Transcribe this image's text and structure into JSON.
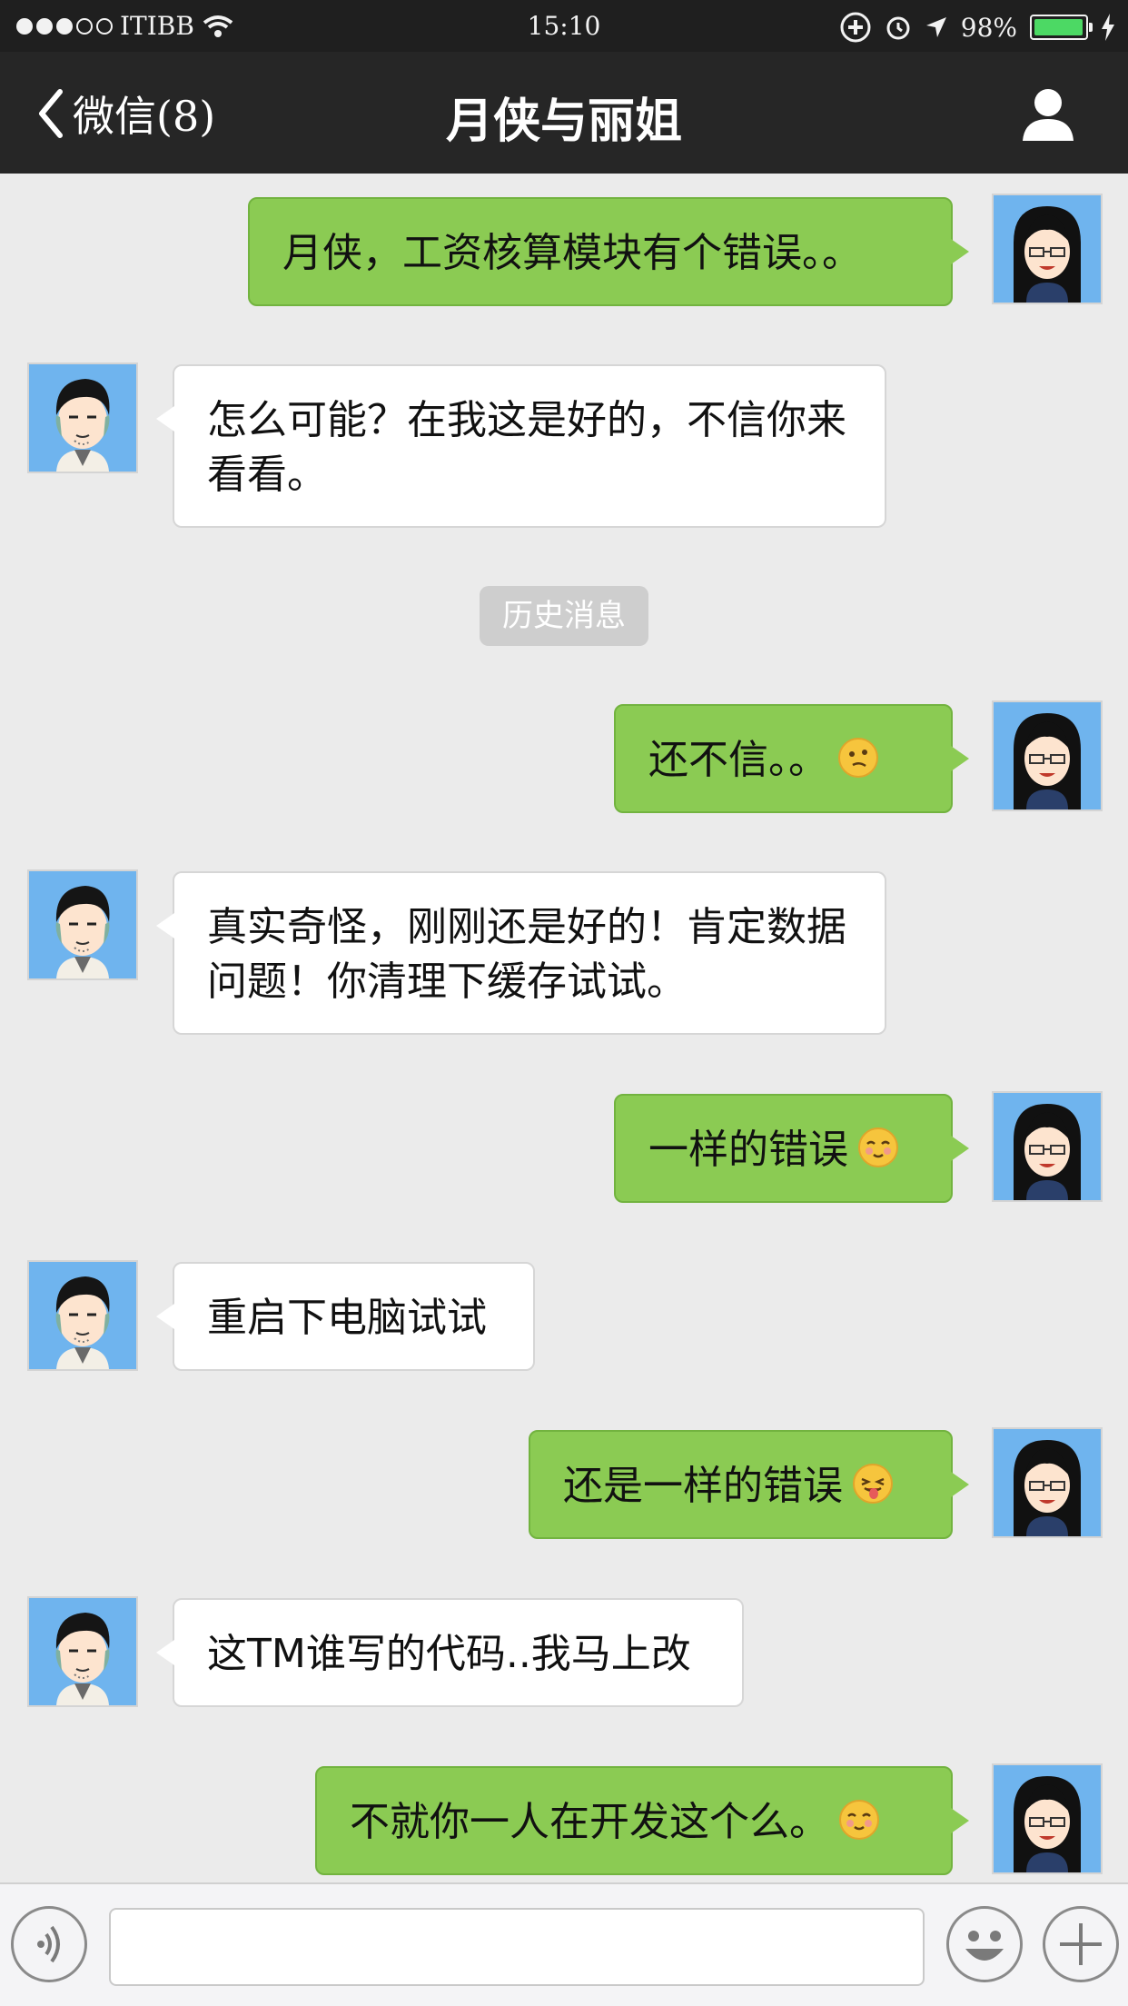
{
  "status_bar": {
    "carrier": "ITIBB",
    "time": "15:10",
    "battery": "98%",
    "battery_level": 0.98
  },
  "nav": {
    "back_label": "微信(8)",
    "title": "月侠与丽姐"
  },
  "history_label": "历史消息",
  "messages": [
    {
      "side": "sent",
      "text": "月侠，工资核算模块有个错误。。",
      "emoji": ""
    },
    {
      "side": "recv",
      "text": "怎么可能？在我这是好的，不信你来看看。",
      "emoji": ""
    },
    {
      "side": "sent",
      "text": "还不信。。",
      "emoji": "thinking-face"
    },
    {
      "side": "recv",
      "text": "真实奇怪，刚刚还是好的！肯定数据问题！你清理下缓存试试。",
      "emoji": ""
    },
    {
      "side": "sent",
      "text": "一样的错误",
      "emoji": "shy-face"
    },
    {
      "side": "recv",
      "text": "重启下电脑试试",
      "emoji": ""
    },
    {
      "side": "sent",
      "text": "还是一样的错误",
      "emoji": "tongue-face"
    },
    {
      "side": "recv",
      "text": "这TM谁写的代码..我马上改",
      "emoji": ""
    },
    {
      "side": "sent",
      "text": "不就你一人在开发这个么。",
      "emoji": "shy-face"
    }
  ],
  "colors": {
    "sent_bubble": "#8bcb53",
    "received_bubble": "#ffffff",
    "nav_background": "#262626"
  }
}
